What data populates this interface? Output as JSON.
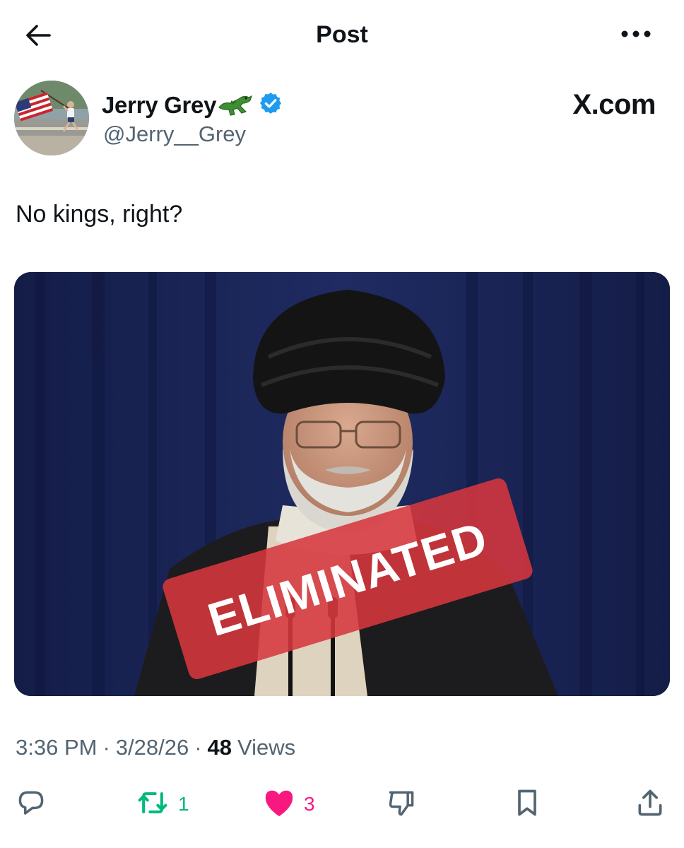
{
  "header": {
    "title": "Post",
    "back_icon": "arrow-left-icon",
    "more_icon": "more-horizontal-icon"
  },
  "author": {
    "display_name": "Jerry Grey",
    "name_emoji": "alligator-emoji",
    "verified_icon": "verified-badge-icon",
    "handle": "@Jerry__Grey",
    "avatar": "avatar-flag-runner"
  },
  "brand_watermark": "X.com",
  "post": {
    "text": "No kings, right?",
    "media": {
      "overlay_text": "ELIMINATED",
      "overlay_color": "#d6373e"
    }
  },
  "meta": {
    "time": "3:36 PM",
    "date": "3/28/26",
    "separator": "·",
    "views_count": "48",
    "views_label": "Views"
  },
  "actions": {
    "reply": {
      "icon": "reply-icon",
      "count": ""
    },
    "repost": {
      "icon": "repost-icon",
      "count": "1",
      "color": "#00ba7c"
    },
    "like": {
      "icon": "heart-filled-icon",
      "count": "3",
      "color": "#f91880"
    },
    "dislike": {
      "icon": "thumbs-down-icon"
    },
    "bookmark": {
      "icon": "bookmark-icon"
    },
    "share": {
      "icon": "share-icon"
    }
  },
  "colors": {
    "text_primary": "#0f1419",
    "text_secondary": "#536471",
    "verified_blue": "#1d9bf0"
  }
}
